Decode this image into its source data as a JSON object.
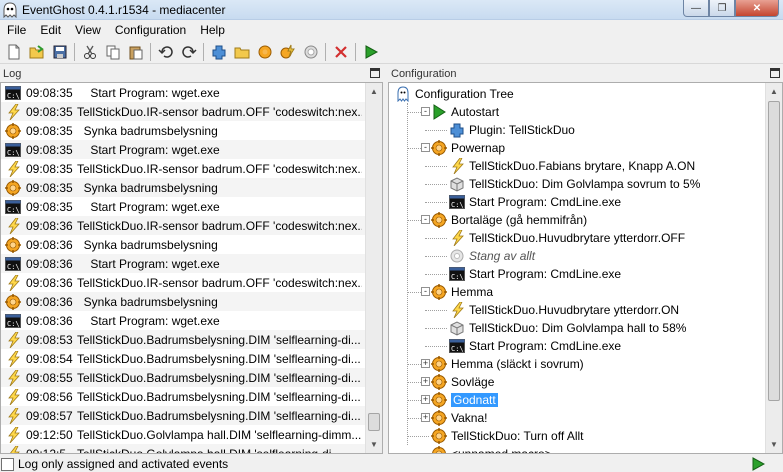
{
  "window": {
    "title": "EventGhost 0.4.1.r1534 - mediacenter",
    "min_label": "—",
    "max_label": "❐",
    "close_label": "✕"
  },
  "menu": [
    "File",
    "Edit",
    "View",
    "Configuration",
    "Help"
  ],
  "toolbar": {
    "icons": [
      "new-file-icon",
      "open-folder-icon",
      "save-icon",
      "cut-icon",
      "copy-icon",
      "paste-icon",
      "undo-icon",
      "redo-icon",
      "add-plugin-icon",
      "add-folder-icon",
      "add-macro-icon",
      "add-event-icon",
      "add-action-icon",
      "delete-icon",
      "execute-icon"
    ]
  },
  "log": {
    "header": "Log",
    "rows": [
      {
        "icon": "console",
        "time": "09:08:35",
        "msg": "    Start Program: wget.exe"
      },
      {
        "icon": "event",
        "time": "09:08:35",
        "msg": "TellStickDuo.IR-sensor badrum.OFF 'codeswitch:nex..."
      },
      {
        "icon": "macro",
        "time": "09:08:35",
        "msg": "  Synka badrumsbelysning"
      },
      {
        "icon": "console",
        "time": "09:08:35",
        "msg": "    Start Program: wget.exe"
      },
      {
        "icon": "event",
        "time": "09:08:35",
        "msg": "TellStickDuo.IR-sensor badrum.OFF 'codeswitch:nex..."
      },
      {
        "icon": "macro",
        "time": "09:08:35",
        "msg": "  Synka badrumsbelysning"
      },
      {
        "icon": "console",
        "time": "09:08:35",
        "msg": "    Start Program: wget.exe"
      },
      {
        "icon": "event",
        "time": "09:08:36",
        "msg": "TellStickDuo.IR-sensor badrum.OFF 'codeswitch:nex..."
      },
      {
        "icon": "macro",
        "time": "09:08:36",
        "msg": "  Synka badrumsbelysning"
      },
      {
        "icon": "console",
        "time": "09:08:36",
        "msg": "    Start Program: wget.exe"
      },
      {
        "icon": "event",
        "time": "09:08:36",
        "msg": "TellStickDuo.IR-sensor badrum.OFF 'codeswitch:nex..."
      },
      {
        "icon": "macro",
        "time": "09:08:36",
        "msg": "  Synka badrumsbelysning"
      },
      {
        "icon": "console",
        "time": "09:08:36",
        "msg": "    Start Program: wget.exe"
      },
      {
        "icon": "event",
        "time": "09:08:53",
        "msg": "TellStickDuo.Badrumsbelysning.DIM 'selflearning-di..."
      },
      {
        "icon": "event",
        "time": "09:08:54",
        "msg": "TellStickDuo.Badrumsbelysning.DIM 'selflearning-di..."
      },
      {
        "icon": "event",
        "time": "09:08:55",
        "msg": "TellStickDuo.Badrumsbelysning.DIM 'selflearning-di..."
      },
      {
        "icon": "event",
        "time": "09:08:56",
        "msg": "TellStickDuo.Badrumsbelysning.DIM 'selflearning-di..."
      },
      {
        "icon": "event",
        "time": "09:08:57",
        "msg": "TellStickDuo.Badrumsbelysning.DIM 'selflearning-di..."
      },
      {
        "icon": "event",
        "time": "09:12:50",
        "msg": "TellStickDuo.Golvlampa hall.DIM 'selflearning-dimm..."
      },
      {
        "icon": "event",
        "time": "09:12:5",
        "msg": "TellStickDuo.Golvlampa hall.DIM 'selflearning-di..."
      }
    ]
  },
  "config": {
    "header": "Configuration",
    "nodes": [
      {
        "text": "Configuration Tree",
        "icon": "root"
      },
      {
        "text": "Autostart",
        "icon": "autostart"
      },
      {
        "text": "Plugin: TellStickDuo",
        "icon": "plugin"
      },
      {
        "text": "Powernap",
        "icon": "folder-macro"
      },
      {
        "text": "TellStickDuo.Fabians brytare, Knapp A.ON",
        "icon": "event"
      },
      {
        "text": "TellStickDuo: Dim Golvlampa sovrum to 5%",
        "icon": "action"
      },
      {
        "text": "Start Program: CmdLine.exe",
        "icon": "console"
      },
      {
        "text": "Bortaläge (gå hemmifrån)",
        "icon": "folder-macro"
      },
      {
        "text": "TellStickDuo.Huvudbrytare ytterdorr.OFF",
        "icon": "event"
      },
      {
        "text": "Stang av allt",
        "icon": "action-disabled"
      },
      {
        "text": "Start Program: CmdLine.exe",
        "icon": "console"
      },
      {
        "text": "Hemma",
        "icon": "folder-macro"
      },
      {
        "text": "TellStickDuo.Huvudbrytare ytterdorr.ON",
        "icon": "event"
      },
      {
        "text": "TellStickDuo: Dim Golvlampa hall to 58%",
        "icon": "action"
      },
      {
        "text": "Start Program: CmdLine.exe",
        "icon": "console"
      },
      {
        "text": "Hemma (släckt i sovrum)",
        "icon": "folder-macro"
      },
      {
        "text": "Sovläge",
        "icon": "folder-macro"
      },
      {
        "text": "Godnatt",
        "icon": "folder-macro"
      },
      {
        "text": "Vakna!",
        "icon": "folder-macro"
      },
      {
        "text": "TellStickDuo: Turn off Allt",
        "icon": "folder-macro"
      },
      {
        "text": "<unnamed macro>",
        "icon": "folder-macro"
      }
    ]
  },
  "status": {
    "checkbox_label": "Log only assigned and activated events"
  }
}
